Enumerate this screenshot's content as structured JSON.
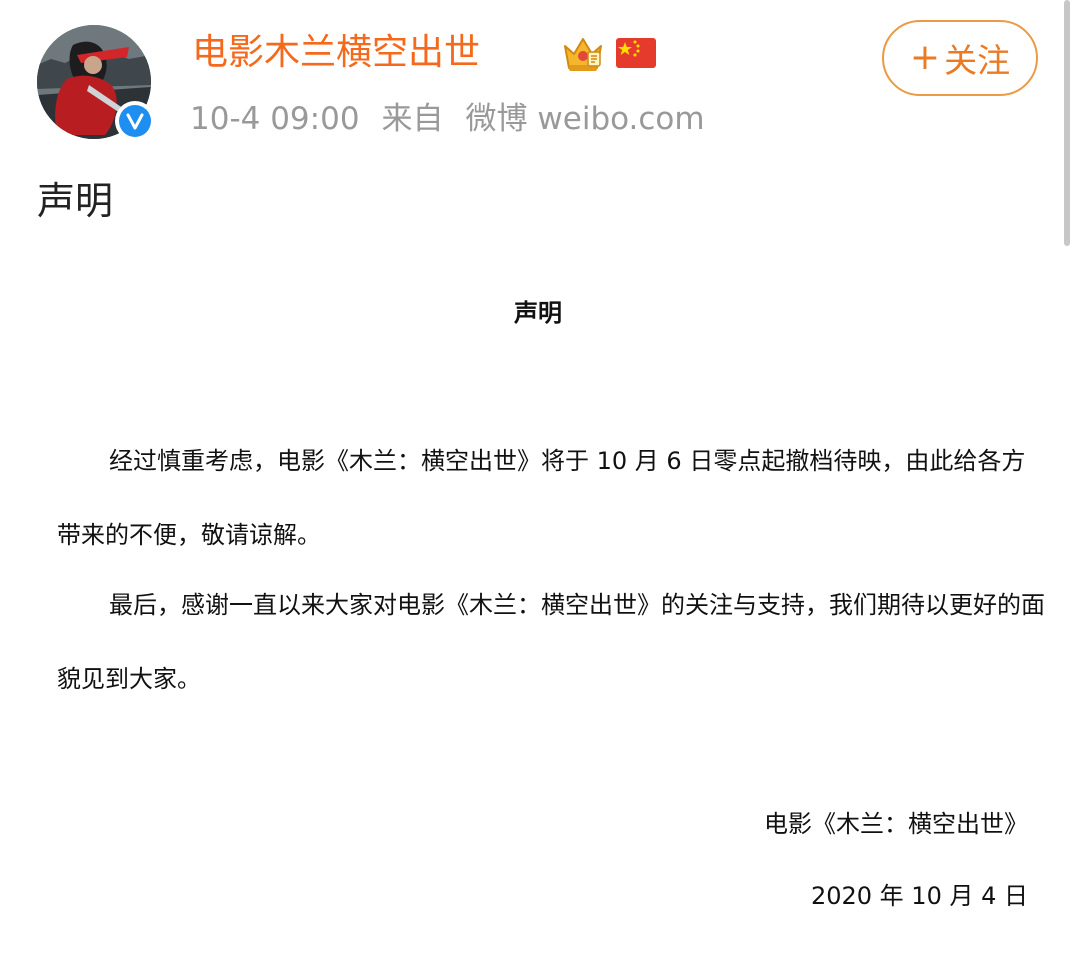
{
  "account": {
    "name": "电影木兰横空出世",
    "avatar_icon": "mulan-avatar",
    "verified_icon": "verified-badge-icon",
    "badge_icons": [
      "crown-icon",
      "china-flag-icon"
    ],
    "brand_color": "#f4691c",
    "verified_color": "#1e8ff0"
  },
  "meta": {
    "time": "10-4 09:00",
    "source_prefix": "来自",
    "source": "微博 weibo.com"
  },
  "follow_button": {
    "plus": "+",
    "label": "关注",
    "color": "#eb7a23"
  },
  "post": {
    "text": "声明"
  },
  "statement": {
    "title": "声明",
    "paragraph_1": "经过慎重考虑，电影《木兰：横空出世》将于 10 月 6 日零点起撤档待映，由此给各方带来的不便，敬请谅解。",
    "paragraph_2": "最后，感谢一直以来大家对电影《木兰：横空出世》的关注与支持，我们期待以更好的面貌见到大家。",
    "signature": "电影《木兰：横空出世》",
    "date": "2020 年 10 月 4 日"
  }
}
